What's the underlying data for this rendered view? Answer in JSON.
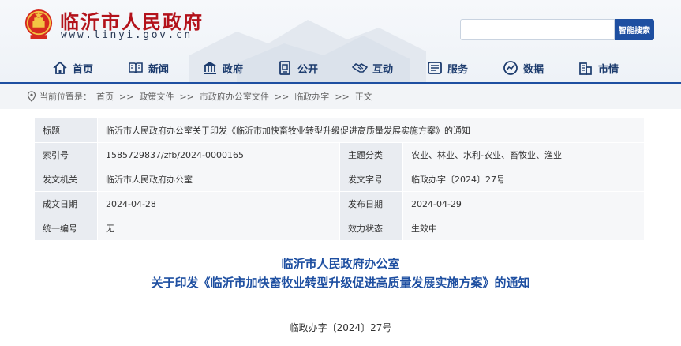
{
  "header": {
    "site_title": "临沂市人民政府",
    "site_url": "www.linyi.gov.cn",
    "search_placeholder": "",
    "search_button": "智能搜索"
  },
  "nav": [
    {
      "label": "首页",
      "icon": "home-icon"
    },
    {
      "label": "新闻",
      "icon": "book-icon"
    },
    {
      "label": "政府",
      "icon": "government-building-icon"
    },
    {
      "label": "公开",
      "icon": "document-icon"
    },
    {
      "label": "互动",
      "icon": "handshake-icon"
    },
    {
      "label": "服务",
      "icon": "list-icon"
    },
    {
      "label": "数据",
      "icon": "chart-icon"
    },
    {
      "label": "市情",
      "icon": "city-icon"
    }
  ],
  "breadcrumb": {
    "prefix": "当前位置是：",
    "items": [
      "首页",
      "政策文件",
      "市政府办公室文件",
      "临政办字",
      "正文"
    ],
    "separator": ">>"
  },
  "info": {
    "title_key": "标题",
    "title_value": "临沂市人民政府办公室关于印发《临沂市加快畜牧业转型升级促进高质量发展实施方案》的通知",
    "rows": [
      {
        "k1": "索引号",
        "v1": "1585729837/zfb/2024-0000165",
        "k2": "主题分类",
        "v2": "农业、林业、水利-农业、畜牧业、渔业"
      },
      {
        "k1": "发文机关",
        "v1": "临沂市人民政府办公室",
        "k2": "发文字号",
        "v2": "临政办字〔2024〕27号"
      },
      {
        "k1": "成文日期",
        "v1": "2024-04-28",
        "k2": "发布日期",
        "v2": "2024-04-29"
      },
      {
        "k1": "统一编号",
        "v1": "无",
        "k2": "效力状态",
        "v2": "生效中"
      }
    ]
  },
  "document": {
    "title_line1": "临沂市人民政府办公室",
    "title_line2": "关于印发《临沂市加快畜牧业转型升级促进高质量发展实施方案》的通知",
    "doc_number": "临政办字〔2024〕27号"
  }
}
